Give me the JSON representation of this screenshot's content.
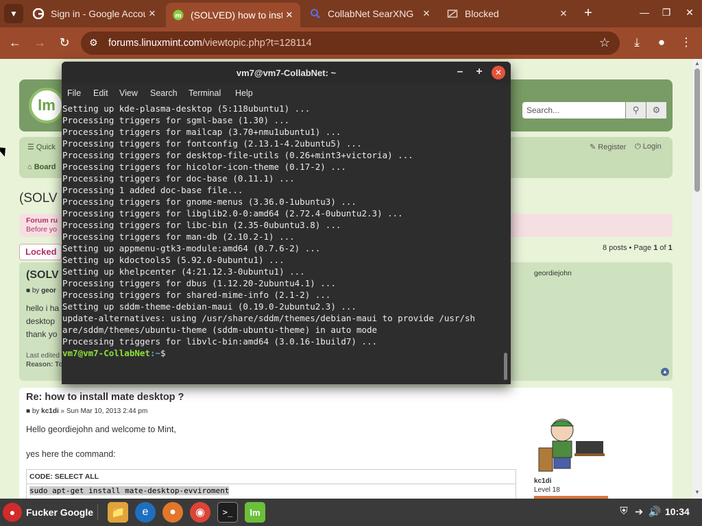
{
  "browser": {
    "tabs": [
      {
        "title": "Sign in - Google Accou",
        "favicon": "google-g-icon",
        "active": false
      },
      {
        "title": "(SOLVED) how to inst",
        "favicon": "mint-icon",
        "active": true
      },
      {
        "title": "CollabNet SearXNG",
        "favicon": "search-icon",
        "active": false
      },
      {
        "title": "Blocked",
        "favicon": "blocked-page-icon",
        "active": false
      }
    ],
    "url_host": "forums.linuxmint.com",
    "url_path": "/viewtopic.php?t=128114",
    "accent_color": "#9b4b2c"
  },
  "forum": {
    "search_placeholder": "Search...",
    "quick_links": "Quick",
    "boards": "Board",
    "register": "Register",
    "login": "Login",
    "topic_title": "(SOLV",
    "rules_line1": "Forum ru",
    "rules_line2": "Before yo",
    "locked": "Locked",
    "pagination_prefix": "8 posts • Page ",
    "pagination_page": "1",
    "pagination_of": " of ",
    "pagination_total": "1",
    "post1": {
      "title": "(SOLV",
      "author_prefix": "by ",
      "author": "geor",
      "body_line1": "hello i ha",
      "body_line2": "desktop",
      "body_line3": "thank yo",
      "edited": "Last edited",
      "reason": "Reason: To",
      "username": "geordiejohn"
    },
    "post2": {
      "title": "Re: how to install mate desktop ?",
      "author_prefix": "by ",
      "author": "kc1di",
      "date": " » Sun Mar 10, 2013 2:44 pm",
      "body1": "Hello geordiejohn and welcome to Mint,",
      "body2": "yes here the command:",
      "code_header": "CODE: SELECT ALL",
      "code": "sudo apt-get install mate-desktop-evviroment",
      "username": "kc1di",
      "rank": "Level 18"
    }
  },
  "terminal": {
    "title": "vm7@vm7-CollabNet: ~",
    "menu": [
      "File",
      "Edit",
      "View",
      "Search",
      "Terminal",
      "Help"
    ],
    "lines": [
      "Setting up kde-plasma-desktop (5:118ubuntu1) ...",
      "Processing triggers for sgml-base (1.30) ...",
      "Processing triggers for mailcap (3.70+nmu1ubuntu1) ...",
      "Processing triggers for fontconfig (2.13.1-4.2ubuntu5) ...",
      "Processing triggers for desktop-file-utils (0.26+mint3+victoria) ...",
      "Processing triggers for hicolor-icon-theme (0.17-2) ...",
      "Processing triggers for doc-base (0.11.1) ...",
      "Processing 1 added doc-base file...",
      "Processing triggers for gnome-menus (3.36.0-1ubuntu3) ...",
      "Processing triggers for libglib2.0-0:amd64 (2.72.4-0ubuntu2.3) ...",
      "Processing triggers for libc-bin (2.35-0ubuntu3.8) ...",
      "Processing triggers for man-db (2.10.2-1) ...",
      "Setting up appmenu-gtk3-module:amd64 (0.7.6-2) ...",
      "Setting up kdoctools5 (5.92.0-0ubuntu1) ...",
      "Setting up khelpcenter (4:21.12.3-0ubuntu1) ...",
      "Processing triggers for dbus (1.12.20-2ubuntu4.1) ...",
      "Processing triggers for shared-mime-info (2.1-2) ...",
      "Setting up sddm-theme-debian-maui (0.19.0-2ubuntu2.3) ...",
      "update-alternatives: using /usr/share/sddm/themes/debian-maui to provide /usr/sh",
      "are/sddm/themes/ubuntu-theme (sddm-ubuntu-theme) in auto mode",
      "Processing triggers for libvlc-bin:amd64 (3.0.16-1build7) ..."
    ],
    "prompt_user": "vm7@vm7-CollabNet",
    "prompt_path": ":~",
    "prompt_symbol": "$"
  },
  "taskbar": {
    "start_label": "Fucker Google",
    "apps": [
      "files-icon",
      "edge-dev-icon",
      "firefox-icon",
      "chrome-icon",
      "terminal-icon",
      "mint-install-icon"
    ],
    "clock": "10:34"
  }
}
